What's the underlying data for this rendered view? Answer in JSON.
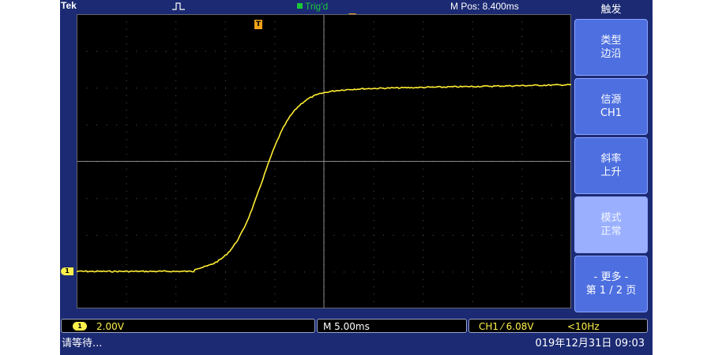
{
  "header": {
    "brand": "Tek",
    "trigger_status": "Trig'd",
    "position": "M Pos: 8.400ms"
  },
  "menu": {
    "title": "触发",
    "buttons": [
      {
        "line1": "类型",
        "line2": "边沿"
      },
      {
        "line1": "信源",
        "line2": "CH1"
      },
      {
        "line1": "斜率",
        "line2": "上升"
      },
      {
        "line1": "模式",
        "line2": "正常"
      },
      {
        "line1": "- 更多 -",
        "line2": "第 1 / 2 页"
      }
    ]
  },
  "markers": {
    "trigger_point": "T",
    "channel": "1"
  },
  "status": {
    "channel_badge": "1",
    "volts_per_div": "2.00V",
    "time_per_div": "M 5.00ms",
    "trigger_readout": "CH1 ⁄ 6.08V",
    "frequency": "<10Hz",
    "message": "请等待...",
    "datetime": "019年12月31日 09:03"
  },
  "colors": {
    "trace": "#ffee33",
    "frame": "#1b2a73",
    "trigger_marker": "#f0a317",
    "trig_status": "#19c937"
  }
}
